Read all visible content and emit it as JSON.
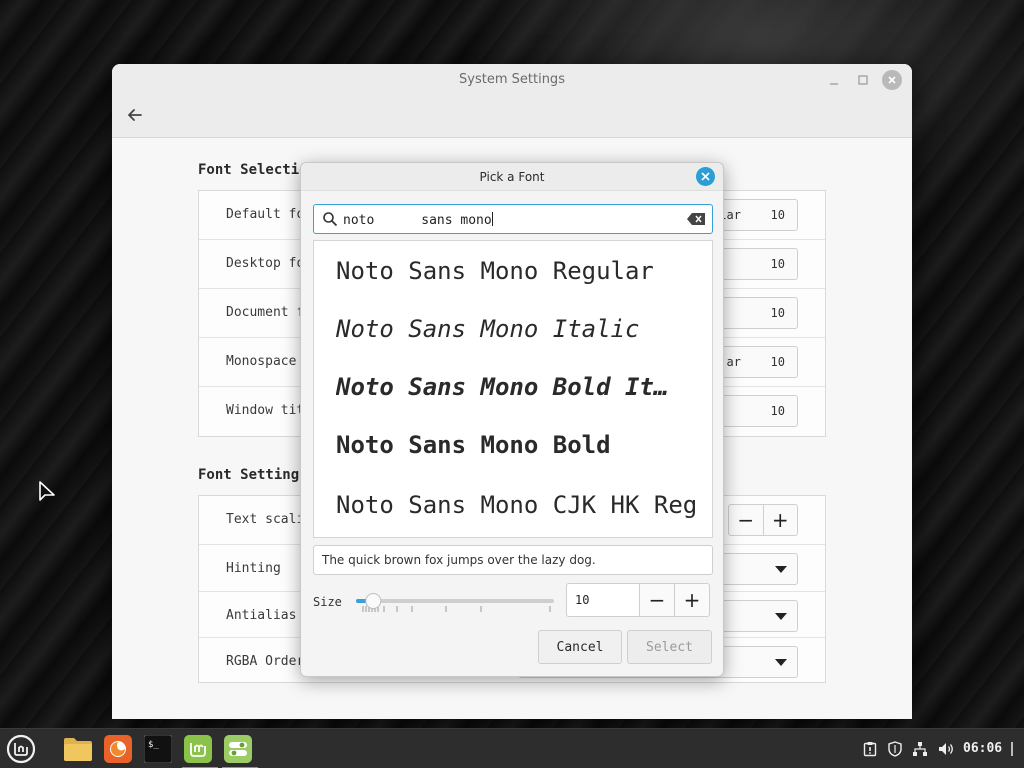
{
  "window": {
    "title": "System Settings",
    "sections": {
      "font_selection": {
        "title": "Font Selection",
        "rows": [
          {
            "label": "Default fo",
            "value": "ular",
            "size": "10"
          },
          {
            "label": "Desktop fo",
            "value": "",
            "size": "10"
          },
          {
            "label": "Document f",
            "value": "",
            "size": "10"
          },
          {
            "label": "Monospace",
            "value": "ar",
            "size": "10"
          },
          {
            "label": "Window tit",
            "value": "",
            "size": "10"
          }
        ]
      },
      "font_settings": {
        "title": "Font Settings",
        "rows": [
          {
            "label": "Text scali"
          },
          {
            "label": "Hinting"
          },
          {
            "label": "Antialias"
          },
          {
            "label": "RGBA Order"
          }
        ]
      }
    }
  },
  "dialog": {
    "title": "Pick a Font",
    "search_value": "noto      sans mono",
    "fonts": [
      "Noto Sans Mono Regular",
      "Noto Sans Mono Italic",
      "Noto Sans Mono Bold It…",
      "Noto Sans Mono Bold",
      "Noto Sans Mono CJK HK Reg…"
    ],
    "preview_text": "The quick brown fox jumps over the lazy dog.",
    "size_label": "Size",
    "size_value": "10",
    "size_slider_fraction": 0.06,
    "cancel_label": "Cancel",
    "select_label": "Select"
  },
  "taskbar": {
    "apps": [
      "menu-icon",
      "files-icon",
      "firefox-icon",
      "terminal-icon",
      "mintinstall-icon",
      "settings-icon"
    ],
    "clock": "06:06"
  }
}
